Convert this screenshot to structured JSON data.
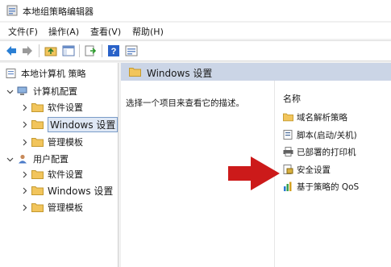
{
  "window": {
    "title": "本地组策略编辑器"
  },
  "menu": [
    "文件(F)",
    "操作(A)",
    "查看(V)",
    "帮助(H)"
  ],
  "tree": {
    "root": "本地计算机 策略",
    "computer_config": "计算机配置",
    "computer_children": [
      "软件设置",
      "Windows 设置",
      "管理模板"
    ],
    "user_config": "用户配置",
    "user_children": [
      "软件设置",
      "Windows 设置",
      "管理模板"
    ]
  },
  "right": {
    "header": "Windows 设置",
    "description": "选择一个项目来查看它的描述。",
    "column_name": "名称",
    "items": [
      "域名解析策略",
      "脚本(启动/关机)",
      "已部署的打印机",
      "安全设置",
      "基于策略的 QoS"
    ]
  },
  "icons": {
    "app": "policy-editor-icon",
    "toolbar": [
      "back-arrow-icon",
      "forward-arrow-icon",
      "up-folder-icon",
      "show-hide-tree-icon",
      "export-list-icon",
      "help-icon",
      "properties-icon"
    ],
    "folder": "folder-icon",
    "annotation": "red-arrow-icon"
  },
  "colors": {
    "accent_header": "#cbd5e6",
    "annotation": "#cc1a1a",
    "folder": "#f2c55c"
  }
}
